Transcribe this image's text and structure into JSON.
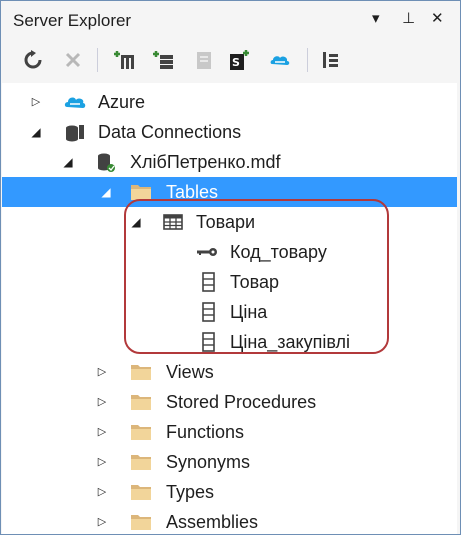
{
  "window": {
    "title": "Server Explorer",
    "controls": {
      "dropdown": "▾",
      "pin": "⊥",
      "close": "✕"
    }
  },
  "toolbar": {
    "tools": [
      {
        "name": "refresh-icon"
      },
      {
        "name": "stop-icon"
      },
      {
        "name": "connect-to-database-icon"
      },
      {
        "name": "connect-to-server-icon"
      },
      {
        "name": "connect-to-sharepoint-icon"
      },
      {
        "name": "connect-to-sql-azure-icon"
      },
      {
        "name": "connect-to-azure-icon"
      },
      {
        "name": "properties-icon"
      }
    ]
  },
  "tree": {
    "azure": "Azure",
    "data_connections": "Data Connections",
    "database": "ХлібПетренко.mdf",
    "tables": "Tables",
    "table_name": "Товари",
    "columns": [
      "Код_товару",
      "Товар",
      "Ціна",
      "Ціна_закупівлі"
    ],
    "folders": [
      "Views",
      "Stored Procedures",
      "Functions",
      "Synonyms",
      "Types",
      "Assemblies"
    ]
  },
  "colors": {
    "selection": "#3399ff",
    "highlight_border": "#b2393b",
    "folder": "#dcb67a",
    "azure_blue": "#1ba1e2"
  }
}
